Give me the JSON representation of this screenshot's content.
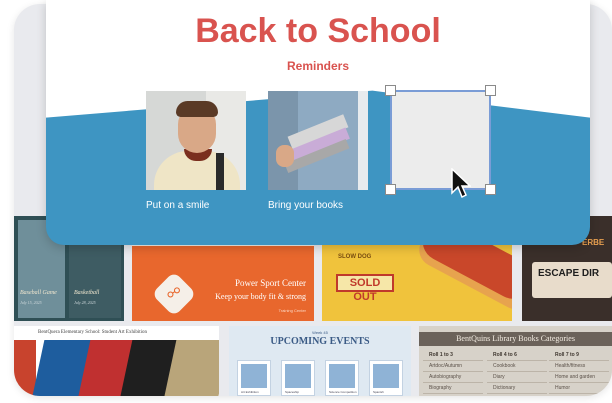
{
  "card": {
    "title": "Back to School",
    "subtitle": "Reminders",
    "photos": [
      {
        "caption": "Put on a smile"
      },
      {
        "caption": "Bring your books"
      }
    ],
    "colors": {
      "title": "#d9534f",
      "band": "#3e95c2",
      "selection": "#7a9cd6"
    }
  },
  "gallery": {
    "sports": {
      "left_caption": "Baseball Game",
      "right_caption": "Basketball",
      "left_date": "July 15, 2025",
      "right_date": "July 28, 2025"
    },
    "power": {
      "title": "Power Sport Center",
      "tagline": "Keep your body fit & strong",
      "small": "Training Center"
    },
    "food": {
      "top": "SLOW DOG",
      "sold_label": "SOLD OUT"
    },
    "escape": {
      "top_text": "ERBE",
      "sign": "ESCAPE DIR"
    },
    "art": {
      "header": "BentQuera Elementary School: Student Art Exhibition"
    },
    "events": {
      "week": "Week 45",
      "title": "UPCOMING EVENTS",
      "items": [
        "Art Exhibition",
        "Spaceship",
        "Science Competition",
        "Spanish"
      ]
    },
    "books": {
      "header": "BentQuins Library Books Categories",
      "columns": [
        {
          "heading": "Roll 1 to 3",
          "rows": [
            "Artdoc/Autumn",
            "Autobiography",
            "Biography"
          ]
        },
        {
          "heading": "Roll 4 to 6",
          "rows": [
            "Cookbook",
            "Diary",
            "Dictionary"
          ]
        },
        {
          "heading": "Roll 7 to 9",
          "rows": [
            "Health/fitness",
            "Home and garden",
            "Humor"
          ]
        }
      ]
    }
  }
}
